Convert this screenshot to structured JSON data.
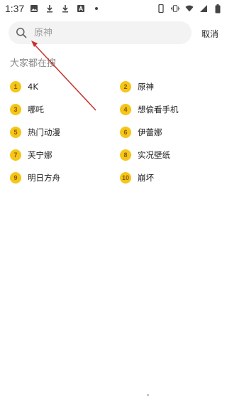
{
  "status_bar": {
    "time": "1:37",
    "left_icons": [
      "image-icon",
      "download-icon",
      "download-icon",
      "a-icon",
      "dot-icon"
    ],
    "right_icons": [
      "phone-icon",
      "vibrate-icon",
      "wifi-icon",
      "signal-icon",
      "battery-icon"
    ]
  },
  "search": {
    "placeholder": "原神",
    "value": ""
  },
  "cancel_label": "取消",
  "section_title": "大家都在搜",
  "hot_items": [
    {
      "rank": "1",
      "label": "4K"
    },
    {
      "rank": "2",
      "label": "原神"
    },
    {
      "rank": "3",
      "label": "哪吒"
    },
    {
      "rank": "4",
      "label": "想偷看手机"
    },
    {
      "rank": "5",
      "label": "热门动漫"
    },
    {
      "rank": "6",
      "label": "伊蕾娜"
    },
    {
      "rank": "7",
      "label": "芙宁娜"
    },
    {
      "rank": "8",
      "label": "实况壁纸"
    },
    {
      "rank": "9",
      "label": "明日方舟"
    },
    {
      "rank": "10",
      "label": "崩坏"
    }
  ],
  "colors": {
    "rank_badge": "#f5c518",
    "annotation_arrow": "#c9302c",
    "search_bg": "#f3f3f3"
  }
}
